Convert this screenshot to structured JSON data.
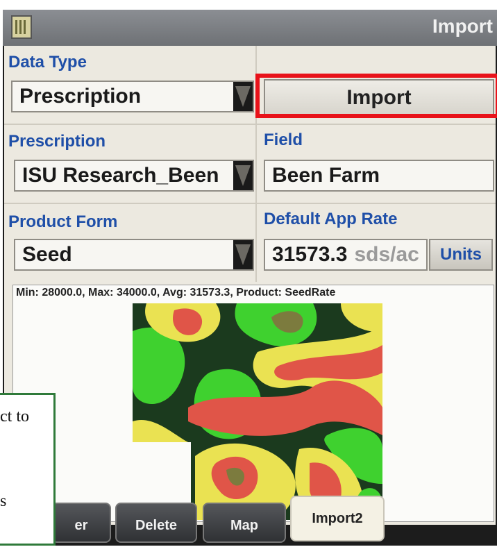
{
  "screen": {
    "title": "Import"
  },
  "form": {
    "data_type": {
      "label": "Data Type",
      "value": "Prescription"
    },
    "import_button": "Import",
    "prescription": {
      "label": "Prescription",
      "value": "ISU Research_Been"
    },
    "field": {
      "label": "Field",
      "value": "Been Farm"
    },
    "product_form": {
      "label": "Product Form",
      "value": "Seed"
    },
    "default_app_rate": {
      "label": "Default App Rate",
      "value": "31573.3",
      "unit": "sds/ac"
    },
    "units_button": "Units"
  },
  "map": {
    "stats": "Min: 28000.0, Max: 34000.0, Avg: 31573.3, Product: SeedRate",
    "zone_colors": {
      "dark": "#1b3a1e",
      "green": "#3fd12f",
      "yellow": "#eae252",
      "red": "#e05548",
      "olive": "#7c7b3e"
    }
  },
  "tabs": [
    {
      "label": "er"
    },
    {
      "label": "Delete"
    },
    {
      "label": "Map"
    },
    {
      "label": "Import2",
      "active": true
    }
  ],
  "overlay": {
    "line1": "ct to",
    "line2": "s"
  },
  "highlight_color": "#e8121a"
}
